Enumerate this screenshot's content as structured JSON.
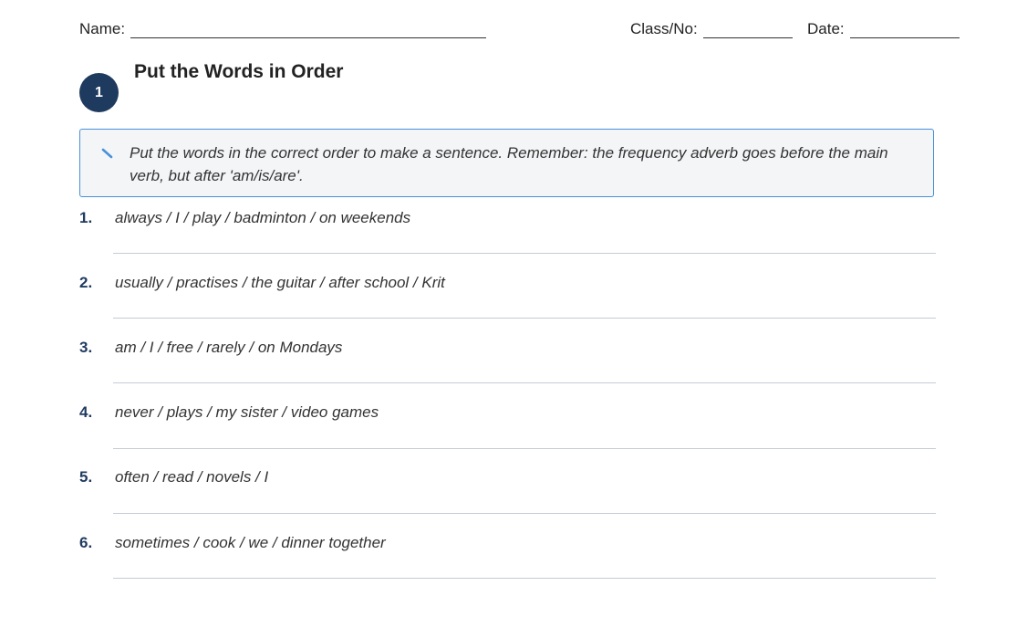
{
  "header": {
    "name_label": "Name:",
    "class_label": "Class/No:",
    "date_label": "Date:"
  },
  "section": {
    "number": "1",
    "title": "Put the Words in Order",
    "instruction": "Put the words in the correct order to make a sentence. Remember: the frequency adverb goes before the main verb, but after 'am/is/are'.",
    "instruction_icon": "pencil-icon",
    "accent_color": "#1f3a5f",
    "box_border_color": "#4a90d9"
  },
  "items": [
    {
      "number": "1.",
      "prompt": "always / I / play / badminton / on weekends"
    },
    {
      "number": "2.",
      "prompt": "usually / practises / the guitar / after school / Krit"
    },
    {
      "number": "3.",
      "prompt": "am / I / free / rarely / on Mondays"
    },
    {
      "number": "4.",
      "prompt": "never / plays / my sister / video games"
    },
    {
      "number": "5.",
      "prompt": "often / read / novels / I"
    },
    {
      "number": "6.",
      "prompt": "sometimes / cook / we / dinner together"
    }
  ]
}
